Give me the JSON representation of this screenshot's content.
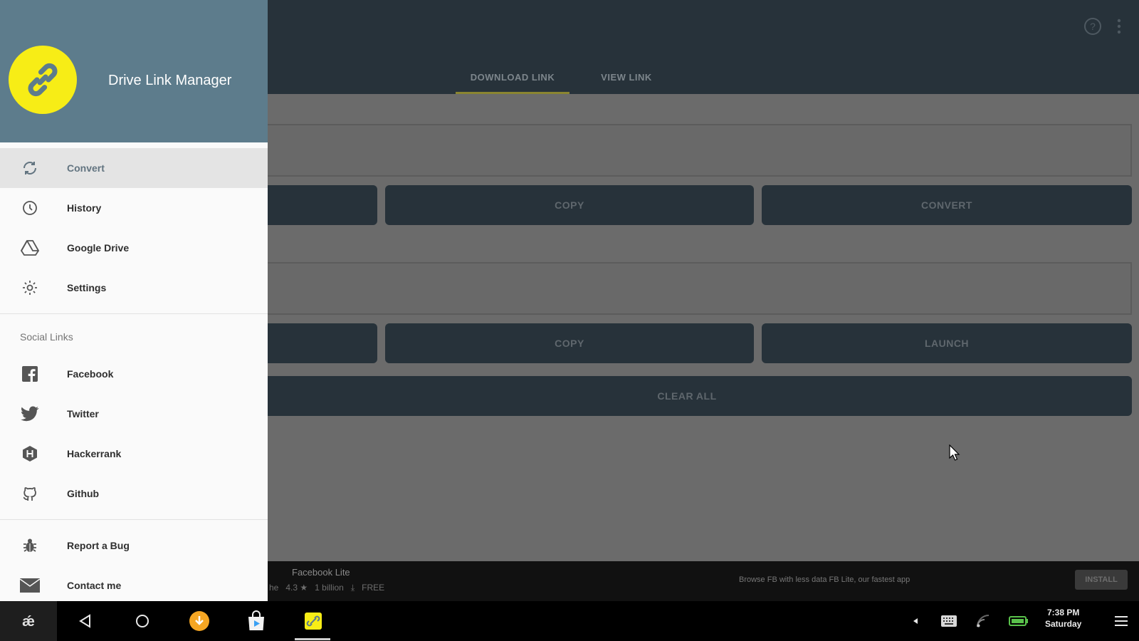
{
  "drawer": {
    "app_name": "Drive Link Manager",
    "menu": [
      {
        "label": "Convert",
        "icon": "refresh-icon",
        "active": true
      },
      {
        "label": "History",
        "icon": "history-icon"
      },
      {
        "label": "Google Drive",
        "icon": "google-drive-icon"
      },
      {
        "label": "Settings",
        "icon": "gear-icon"
      }
    ],
    "social_header": "Social Links",
    "social": [
      {
        "label": "Facebook",
        "icon": "facebook-icon"
      },
      {
        "label": "Twitter",
        "icon": "twitter-icon"
      },
      {
        "label": "Hackerrank",
        "icon": "hackerrank-icon"
      },
      {
        "label": "Github",
        "icon": "github-icon"
      }
    ],
    "extra": [
      {
        "label": "Report a Bug",
        "icon": "bug-icon"
      },
      {
        "label": "Contact me",
        "icon": "mail-icon"
      }
    ]
  },
  "appbar": {
    "tabs": [
      {
        "label": "DOWNLOAD LINK",
        "active": true
      },
      {
        "label": "VIEW LINK",
        "active": false
      }
    ]
  },
  "main": {
    "row1": {
      "copy_label": "COPY",
      "convert_label": "CONVERT"
    },
    "row2": {
      "copy_label": "COPY",
      "launch_label": "LAUNCH"
    },
    "clear_label": "CLEAR ALL"
  },
  "ad": {
    "title": "Facebook Lite",
    "meta_prefix": "he",
    "rating": "4.3 ★",
    "downloads": "1 billion",
    "price": "FREE",
    "description": "Browse FB with less data FB Lite, our fastest app",
    "install_label": "INSTALL"
  },
  "taskbar": {
    "time": "7:38 PM",
    "day": "Saturday"
  },
  "colors": {
    "drawer_header": "#5d7c8c",
    "logo_yellow": "#f7ed16",
    "appbar": "#27323a"
  }
}
